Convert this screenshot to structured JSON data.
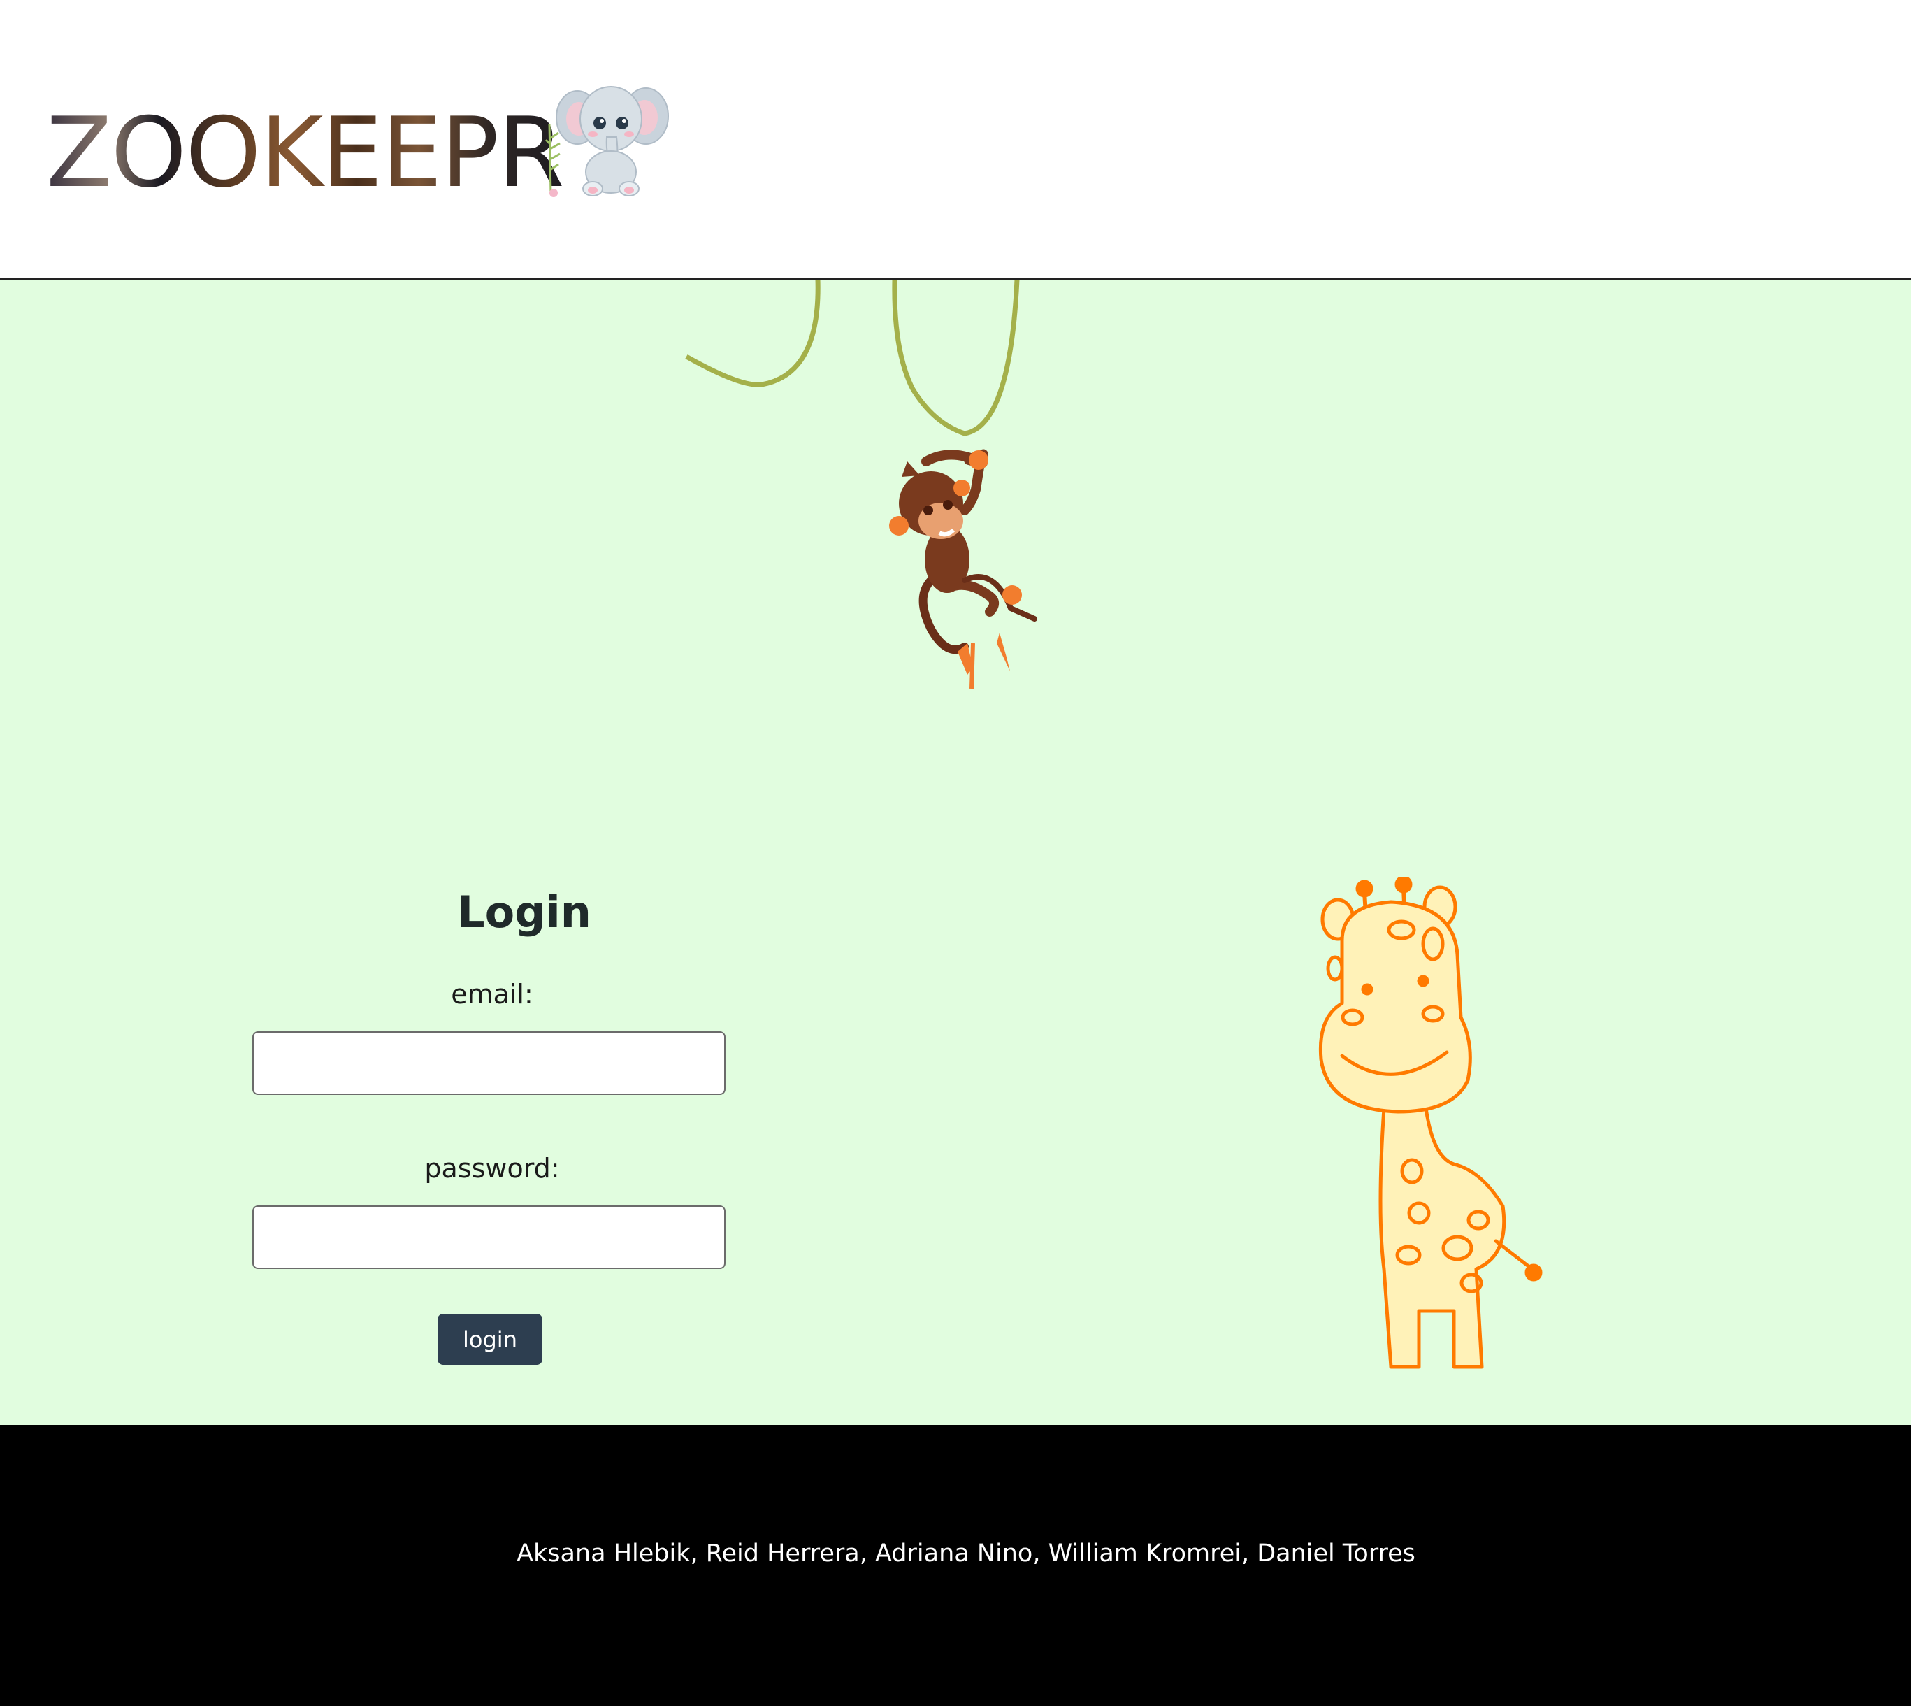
{
  "header": {
    "logo_text": "ZOOKEEPR"
  },
  "login": {
    "title": "Login",
    "email_label": "email:",
    "email_value": "",
    "password_label": "password:",
    "password_value": "",
    "button_label": "login"
  },
  "footer": {
    "credits": "Aksana Hlebik, Reid Herrera, Adriana Nino, William Kromrei, Daniel Torres"
  },
  "colors": {
    "header_bg": "#ffffff",
    "main_bg": "#e1fddf",
    "footer_bg": "#000000",
    "button_bg": "#2d3e50",
    "vine": "#a4b04a",
    "giraffe_outline": "#ff7a00",
    "giraffe_fill": "#fff2b8",
    "monkey_body": "#7a3a1e"
  },
  "illustrations": {
    "logo": "elephant-icon",
    "hero_top": "monkey-icon",
    "hero_right": "giraffe-icon"
  }
}
